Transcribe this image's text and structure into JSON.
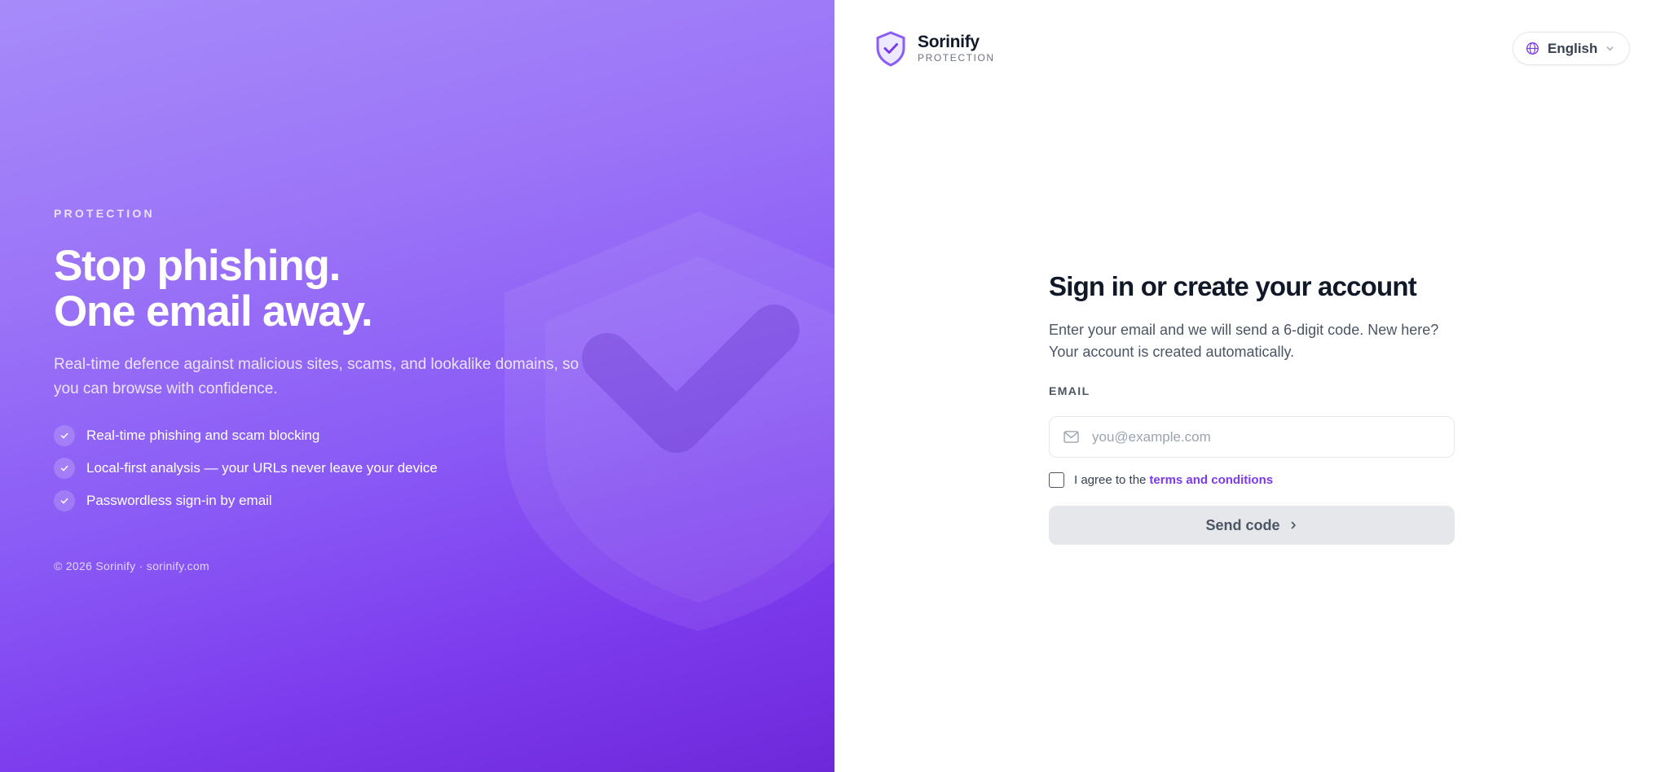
{
  "hero": {
    "eyebrow": "PROTECTION",
    "headline_line1": "Stop phishing.",
    "headline_line2": "One email away.",
    "subtext": "Real-time defence against malicious sites, scams, and lookalike domains, so you can browse with confidence.",
    "features": [
      {
        "label": "Real-time phishing and scam blocking",
        "icon": "check-icon"
      },
      {
        "label": "Local-first analysis — your URLs never leave your device",
        "icon": "check-icon"
      },
      {
        "label": "Passwordless sign-in by email",
        "icon": "check-icon"
      }
    ],
    "copyright": "© 2026 Sorinify · sorinify.com",
    "background_icon": "shield-check-icon"
  },
  "brand": {
    "name": "Sorinify",
    "tagline": "PROTECTION",
    "logo_icon": "shield-check-icon"
  },
  "language_selector": {
    "selected": "English",
    "icon": "globe-icon"
  },
  "form": {
    "title": "Sign in or create your account",
    "description": "Enter your email and we will send a 6-digit code. New here? Your account is created automatically.",
    "email_label": "EMAIL",
    "email_value": "",
    "email_placeholder": "you@example.com",
    "email_icon": "mail-icon",
    "agree_prefix": "I agree to the",
    "terms_link": "terms and conditions",
    "agree_checked": false,
    "submit_label": "Send code"
  },
  "colors": {
    "accent": "#7c3aed",
    "hero_gradient_start": "#a78bfa",
    "hero_gradient_end": "#6d28d9",
    "button_disabled_bg": "#e5e7eb",
    "heading_text": "#111827"
  }
}
